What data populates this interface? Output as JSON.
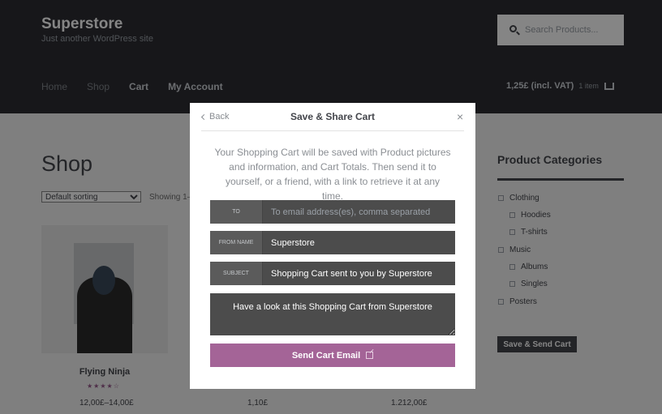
{
  "site": {
    "title": "Superstore",
    "tagline": "Just another WordPress site"
  },
  "search": {
    "placeholder": "Search Products..."
  },
  "nav": {
    "items": [
      "Home",
      "Shop",
      "Cart",
      "My Account"
    ]
  },
  "cart": {
    "total": "1,25£ (incl. VAT)",
    "count": "1 item"
  },
  "shop": {
    "title": "Shop",
    "sorting": "Default sorting",
    "showing": "Showing 1–",
    "products": [
      {
        "name": "Flying Ninja",
        "price": "12,00£–14,00£",
        "rating": 4
      },
      {
        "name": "",
        "price": "1,10£",
        "rating": null
      },
      {
        "name": "",
        "price": "1.212,00£",
        "rating": null
      }
    ]
  },
  "sidebar": {
    "title": "Product Categories",
    "categories": [
      "Clothing",
      "Hoodies",
      "T-shirts",
      "Music",
      "Albums",
      "Singles",
      "Posters"
    ],
    "button_label": "Save & Send Cart"
  },
  "modal": {
    "back_label": "Back",
    "title": "Save & Share Cart",
    "close_glyph": "×",
    "intro": "Your Shopping Cart will be saved with Product pictures and information, and Cart Totals. Then send it to yourself, or a friend, with a link to retrieve it at any time.",
    "fields": {
      "to": {
        "label": "TO",
        "value": "",
        "placeholder": "To email address(es), comma separated"
      },
      "from_name": {
        "label": "FROM NAME",
        "value": "Superstore"
      },
      "subject": {
        "label": "SUBJECT",
        "value": "Shopping Cart sent to you by Superstore"
      }
    },
    "message": "Have a look at this Shopping Cart from Superstore",
    "send_label": "Send Cart Email"
  },
  "colors": {
    "header_bg": "#2c2d33",
    "accent": "#a46497",
    "field_bg": "#4c4c4c"
  }
}
